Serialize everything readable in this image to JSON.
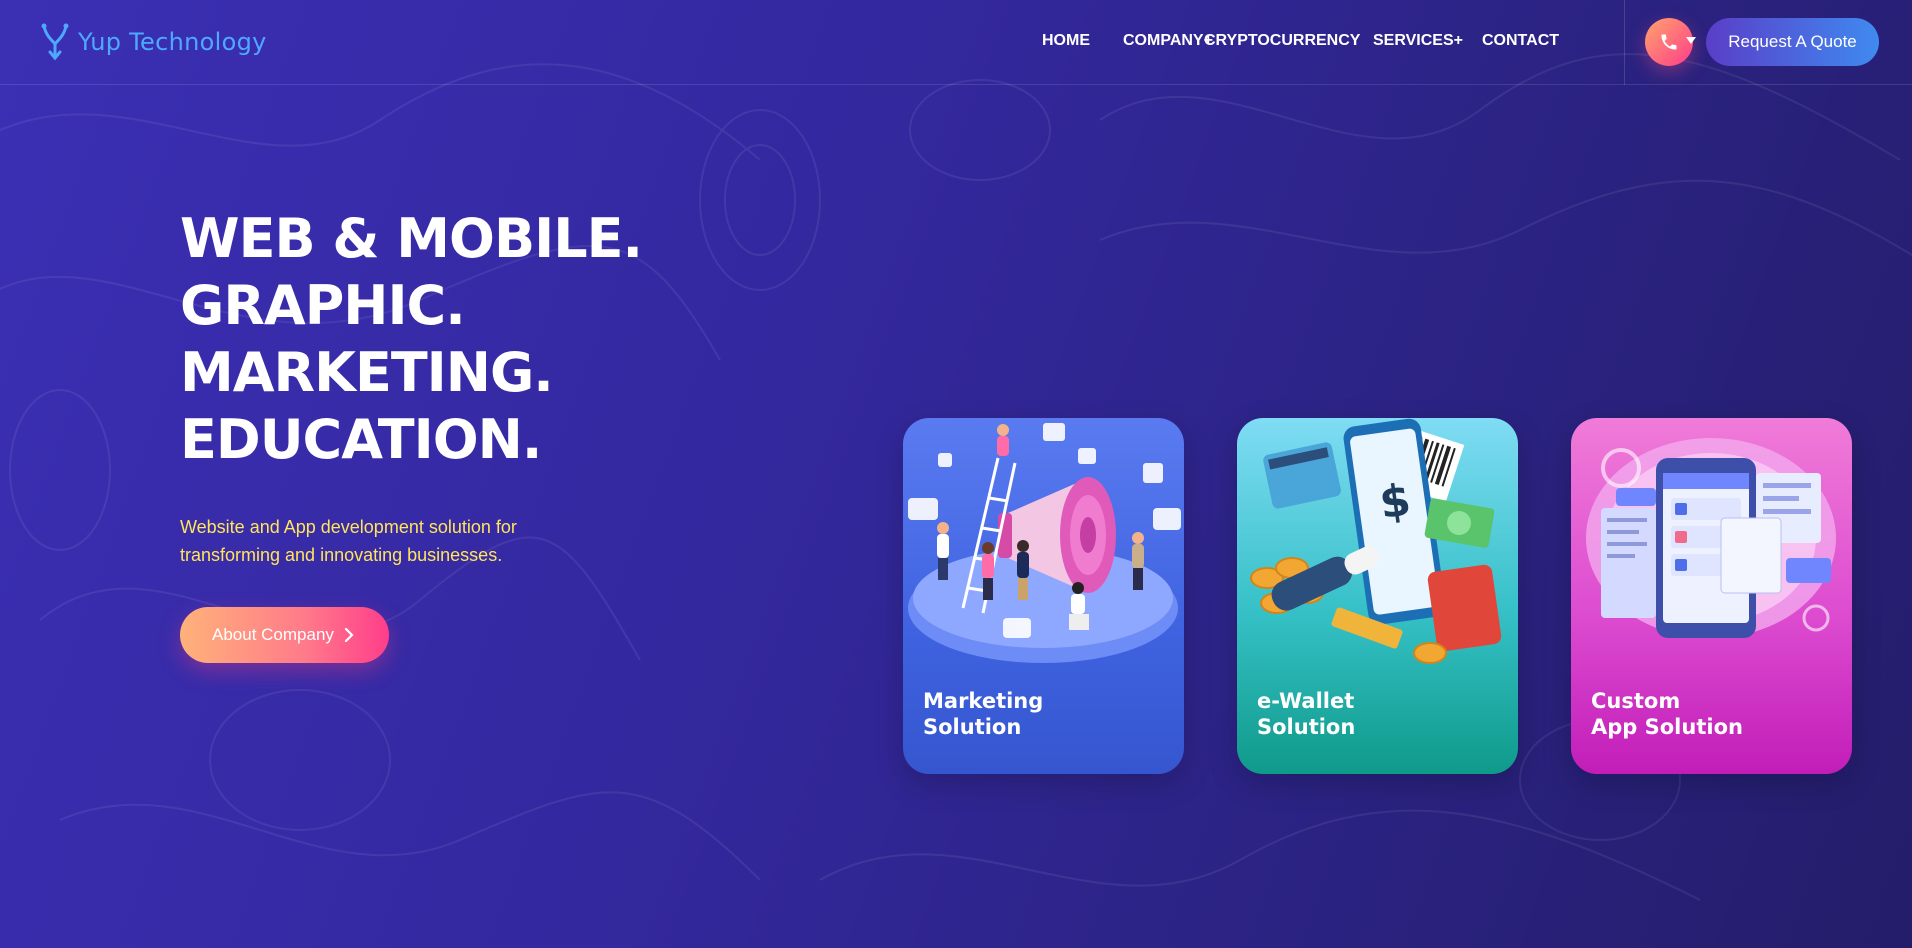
{
  "brand": {
    "name": "Yup Technology",
    "logo_icon": "y-logo-icon",
    "color": "#4fa8ff"
  },
  "nav": {
    "items": [
      {
        "label": "HOME"
      },
      {
        "label": "COMPANY+"
      },
      {
        "label": "CRYPTOCURRENCY"
      },
      {
        "label": "SERVICES+"
      },
      {
        "label": "CONTACT"
      }
    ],
    "phone_icon": "phone-icon",
    "quote_label": "Request A Quote"
  },
  "hero": {
    "lines": [
      "WEB & MOBILE.",
      "GRAPHIC.",
      "MARKETING.",
      "EDUCATION."
    ],
    "subtitle_line1": "Website and App development solution for",
    "subtitle_line2": "transforming and innovating businesses.",
    "cta_label": "About Company",
    "cta_icon": "chevron-right-icon"
  },
  "cards": [
    {
      "line1": "Marketing",
      "line2": "Solution",
      "illustration": "megaphone-team-illustration"
    },
    {
      "line1": "e-Wallet",
      "line2": "Solution",
      "illustration": "mobile-wallet-illustration"
    },
    {
      "line1": "Custom",
      "line2": "App Solution",
      "illustration": "app-screens-illustration"
    }
  ],
  "colors": {
    "accent_yellow": "#ffe45c",
    "button_pink": "#ff3d8b",
    "button_orange": "#ffb27a"
  }
}
